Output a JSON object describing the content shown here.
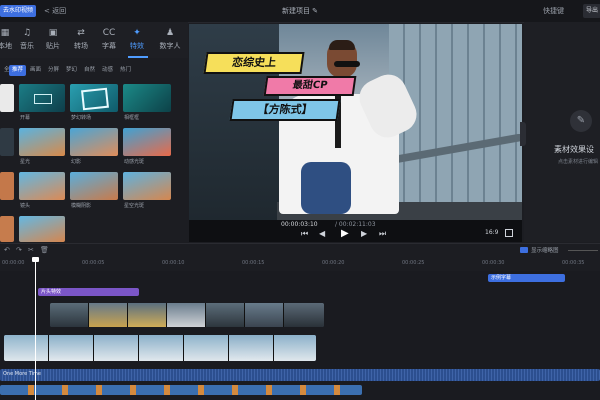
{
  "topbar": {
    "badge": "去水印视频",
    "back": "< 返回",
    "project_title": "新建项目 ✎",
    "shortcut": "快捷键",
    "export": "导出"
  },
  "left_tabs": [
    {
      "icon": "▦",
      "label": "本地"
    },
    {
      "icon": "♫",
      "label": "音乐"
    },
    {
      "icon": "▣",
      "label": "贴片"
    },
    {
      "icon": "⇄",
      "label": "转场"
    },
    {
      "icon": "CC",
      "label": "字幕"
    },
    {
      "icon": "✦",
      "label": "特效"
    },
    {
      "icon": "♟",
      "label": "数字人"
    }
  ],
  "sub_tabs": [
    "推荐",
    "画面",
    "分屏",
    "梦幻",
    "自然",
    "动感",
    "热门"
  ],
  "effect_items": [
    "开幕",
    "梦幻转场",
    "相框框",
    "模糊背景",
    "星光",
    "幻影",
    "动感光斑",
    "镜头",
    "模糊阴影",
    "星空光斑",
    "闪光"
  ],
  "preview_captions": {
    "line1": "恋综史上",
    "line2": "最甜CP",
    "line3": "【方陈式】"
  },
  "player": {
    "current_time": "00:00:03:10",
    "total_time": "/ 00:02:11:03",
    "ratio": "16:9"
  },
  "right_panel": {
    "title": "素材效果设",
    "hint": "点击素材进行编辑"
  },
  "timeline": {
    "ticks": [
      "00:00:00",
      "00:00:05",
      "00:00:10",
      "00:00:15",
      "00:00:20",
      "00:00:25",
      "00:00:30",
      "00:00:35"
    ],
    "subtitle_clip": "示例字幕",
    "effect_clip": "片头特效",
    "audio_label": "One More Time",
    "show_thumbs": "显示缩略图"
  },
  "colors": {
    "accent": "#3d6fe0",
    "caption_yellow": "#f6df5a",
    "caption_pink": "#f07aa8",
    "caption_blue": "#7fc6e8",
    "effect_clip": "#7b56c7",
    "audio": "#2c4f8f"
  }
}
